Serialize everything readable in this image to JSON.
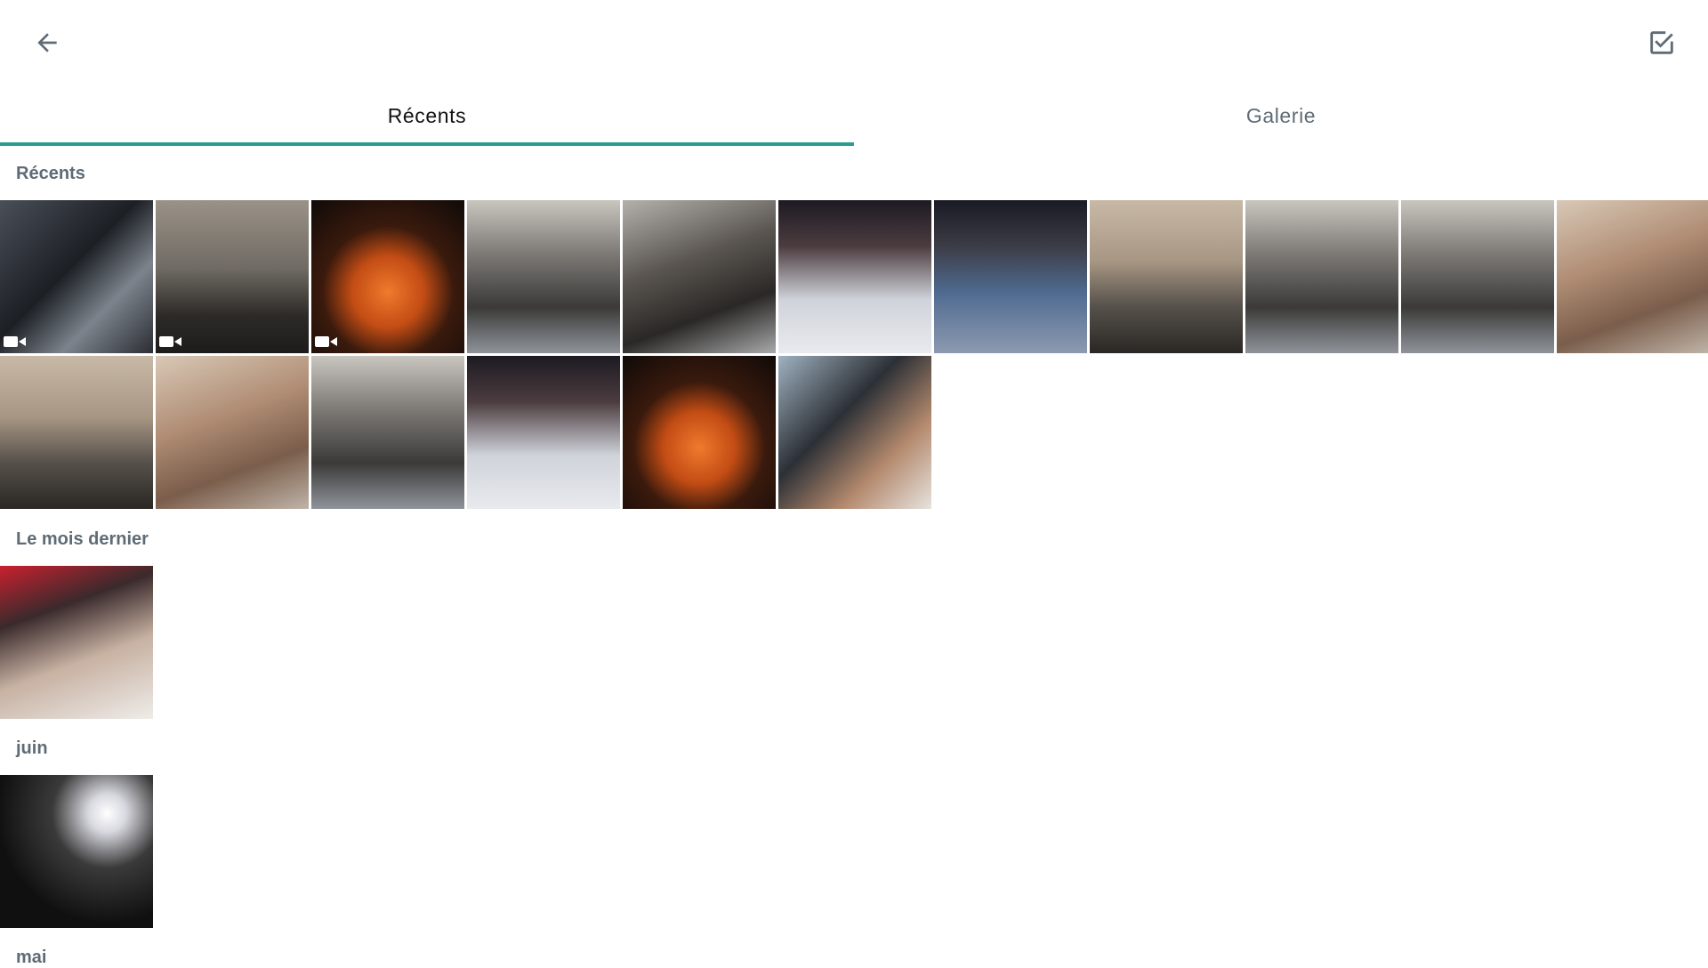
{
  "colors": {
    "accent": "#2a9d8f",
    "icon": "#5f6b75"
  },
  "header": {
    "back_icon": "arrow-left-icon",
    "select_icon": "checkbox-checked-icon"
  },
  "tabs": [
    {
      "label": "Récents",
      "active": true
    },
    {
      "label": "Galerie",
      "active": false
    }
  ],
  "sections": [
    {
      "label": "Récents",
      "items": 17
    },
    {
      "label": "Le mois dernier",
      "items": 1
    },
    {
      "label": "juin",
      "items": 1
    },
    {
      "label": "mai",
      "items": 0
    }
  ],
  "media": [
    {
      "subject": "car-dashboard",
      "video": true
    },
    {
      "subject": "tree-sunset",
      "video": true
    },
    {
      "subject": "campfire-pan",
      "video": true
    },
    {
      "subject": "car-selfie-group",
      "video": false
    },
    {
      "subject": "car-selfie-two",
      "video": false
    },
    {
      "subject": "man-white-shirt",
      "video": false
    },
    {
      "subject": "two-men-blue-shirts",
      "video": false
    },
    {
      "subject": "beach-sunset-silhouette",
      "video": false
    },
    {
      "subject": "car-selfie-group",
      "video": false
    },
    {
      "subject": "car-selfie-group",
      "video": false
    },
    {
      "subject": "beach-selfie",
      "video": false
    },
    {
      "subject": "beach-sunset-silhouette",
      "video": false
    },
    {
      "subject": "beach-selfie",
      "video": false
    },
    {
      "subject": "car-selfie-group",
      "video": false
    },
    {
      "subject": "man-white-shirt",
      "video": false
    },
    {
      "subject": "campfire-pan",
      "video": false
    },
    {
      "subject": "car-window-selfie",
      "video": false
    },
    {
      "subject": "women-selfie",
      "video": false
    },
    {
      "subject": "dark-night-light",
      "video": false
    }
  ]
}
